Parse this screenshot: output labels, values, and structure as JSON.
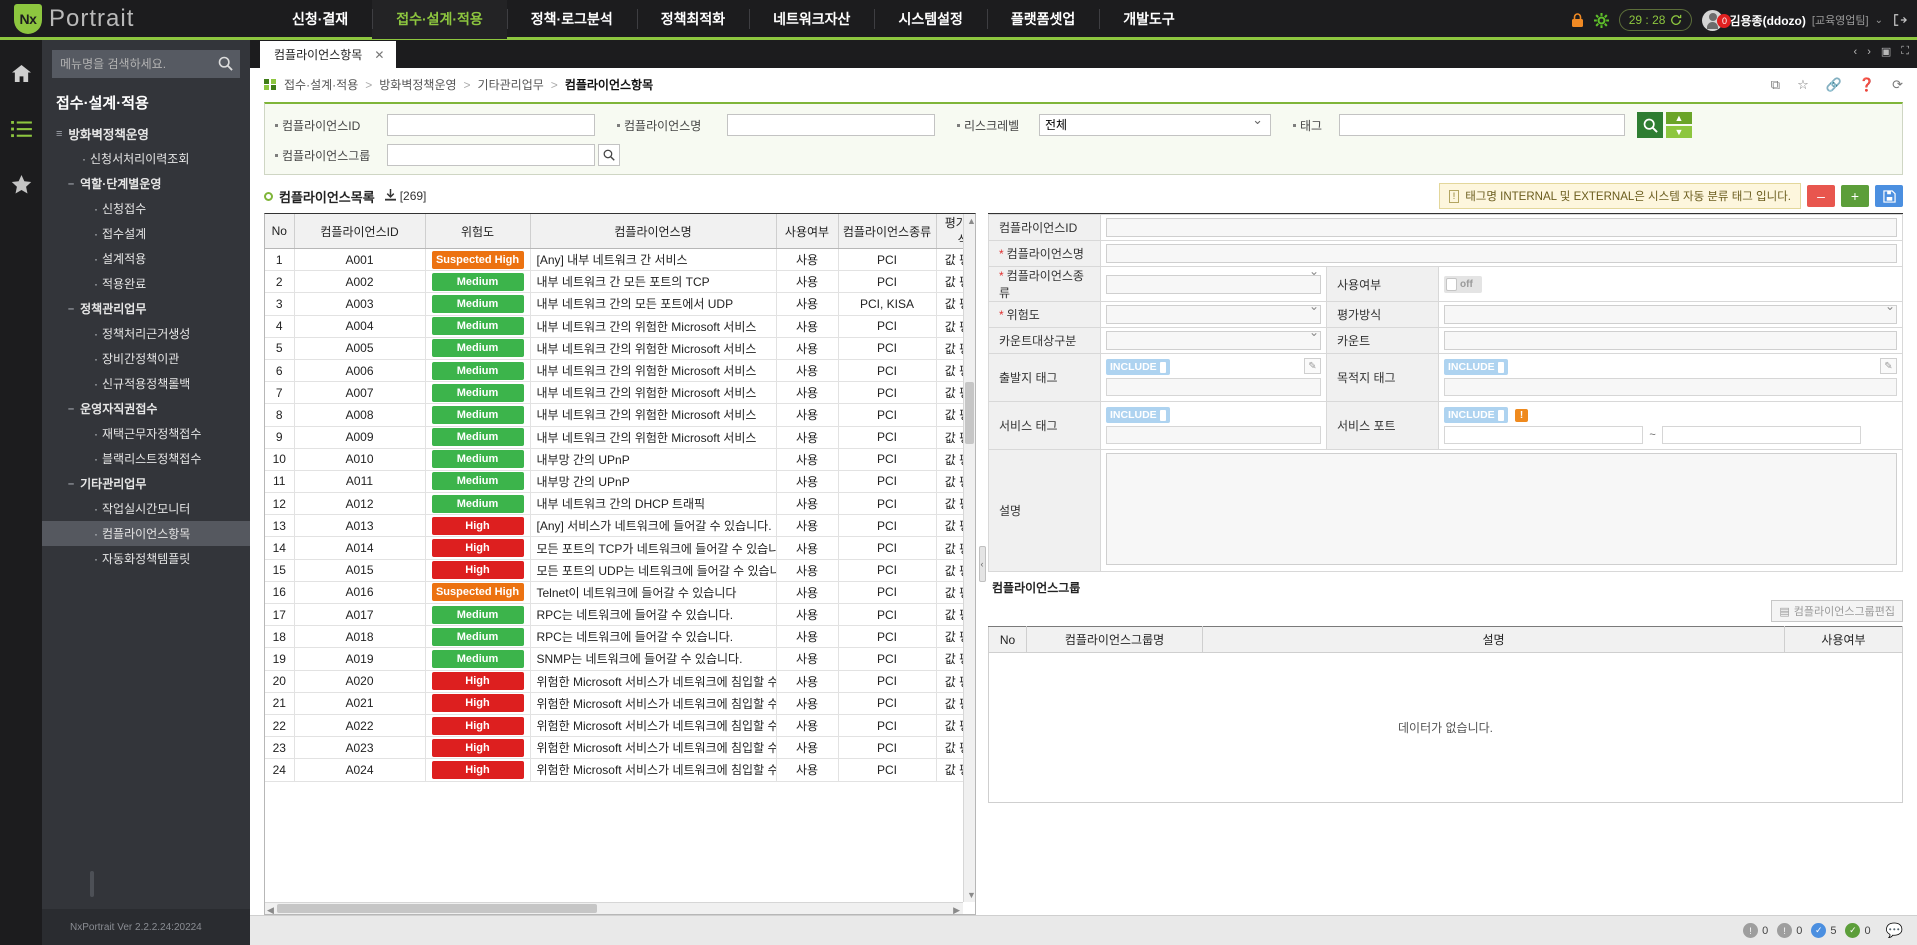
{
  "app": {
    "logo_mark": "Nx",
    "logo_text": "Portrait",
    "version": "NxPortrait  Ver 2.2.2.24:20224"
  },
  "header": {
    "nav": [
      {
        "label": "신청·결재",
        "active": false
      },
      {
        "label": "접수·설계·적용",
        "active": true
      },
      {
        "label": "정책·로그분석",
        "active": false
      },
      {
        "label": "정책최적화",
        "active": false
      },
      {
        "label": "네트워크자산",
        "active": false
      },
      {
        "label": "시스템설정",
        "active": false
      },
      {
        "label": "플랫폼셋업",
        "active": false
      },
      {
        "label": "개발도구",
        "active": false
      }
    ],
    "lock_icon": "lock-icon",
    "gear_icon": "gear-icon",
    "session_timer": "29 : 28",
    "refresh_icon": "session-refresh-icon",
    "notification_count": "0",
    "user_name": "김용종(ddozo)",
    "user_team": "[교육영업팀]",
    "logout_icon": "logout-icon"
  },
  "rail": {
    "home_icon": "home-icon",
    "menu_icon": "menu-list-icon",
    "favorite_icon": "star-icon"
  },
  "sidebar": {
    "search_placeholder": "메뉴명을 검색하세요.",
    "search_icon": "search-icon",
    "title": "접수·설계·적용",
    "tree": [
      {
        "label": "방화벽정책운영",
        "level": 1,
        "marker": "≡",
        "selected": false
      },
      {
        "label": "신청서처리이력조회",
        "level": 3,
        "marker": "·",
        "selected": false
      },
      {
        "label": "역할·단계별운영",
        "level": 2,
        "marker": "–",
        "selected": false
      },
      {
        "label": "신청접수",
        "level": 4,
        "marker": "·",
        "selected": false
      },
      {
        "label": "접수설계",
        "level": 4,
        "marker": "·",
        "selected": false
      },
      {
        "label": "설계적용",
        "level": 4,
        "marker": "·",
        "selected": false
      },
      {
        "label": "적용완료",
        "level": 4,
        "marker": "·",
        "selected": false
      },
      {
        "label": "정책관리업무",
        "level": 2,
        "marker": "–",
        "selected": false
      },
      {
        "label": "정책처리근거생성",
        "level": 4,
        "marker": "·",
        "selected": false
      },
      {
        "label": "장비간정책이관",
        "level": 4,
        "marker": "·",
        "selected": false
      },
      {
        "label": "신규적용정책롤백",
        "level": 4,
        "marker": "·",
        "selected": false
      },
      {
        "label": "운영자직권접수",
        "level": 2,
        "marker": "–",
        "selected": false
      },
      {
        "label": "재택근무자정책접수",
        "level": 4,
        "marker": "·",
        "selected": false
      },
      {
        "label": "블랙리스트정책접수",
        "level": 4,
        "marker": "·",
        "selected": false
      },
      {
        "label": "기타관리업무",
        "level": 2,
        "marker": "–",
        "selected": false
      },
      {
        "label": "작업실시간모니터",
        "level": 4,
        "marker": "·",
        "selected": false
      },
      {
        "label": "컴플라이언스항목",
        "level": 4,
        "marker": "·",
        "selected": true
      },
      {
        "label": "자동화정책템플릿",
        "level": 4,
        "marker": "·",
        "selected": false
      }
    ]
  },
  "tabs": {
    "items": [
      {
        "label": "컴플라이언스항목",
        "close_icon": "close-icon"
      }
    ],
    "prev_icon": "chevron-left-icon",
    "next_icon": "chevron-right-icon",
    "window_icon": "window-icon",
    "expand_icon": "expand-icon"
  },
  "breadcrumb": {
    "grid_icon": "grid-icon",
    "items": [
      "접수·설계·적용",
      "방화벽정책운영",
      "기타관리업무"
    ],
    "current": "컴플라이언스항목",
    "actions": [
      "screen-capture-icon",
      "favorite-star-icon",
      "link-icon",
      "help-icon",
      "refresh-icon"
    ]
  },
  "search_form": {
    "fields": [
      {
        "label": "컴플라이언스ID",
        "value": "",
        "type": "text"
      },
      {
        "label": "컴플라이언스명",
        "value": "",
        "type": "text"
      },
      {
        "label": "리스크레벨",
        "value": "전체",
        "type": "select"
      },
      {
        "label": "태그",
        "value": "",
        "type": "text"
      },
      {
        "label": "컴플라이언스그룹",
        "value": "",
        "type": "text-with-search"
      }
    ],
    "search_icon": "search-icon",
    "popup_icon": "popup-search-icon",
    "collapse_icon": "collapse-icon"
  },
  "list_header": {
    "title": "컴플라이언스목록",
    "download_icon": "download-icon",
    "count": "[269]",
    "notice_icon": "exclamation-icon",
    "notice_text": "태그명 INTERNAL 및 EXTERNAL은 시스템 자동 분류 태그 입니다.",
    "buttons": [
      {
        "name": "delete-button",
        "glyph": "–",
        "color": "#e8564e"
      },
      {
        "name": "add-button",
        "glyph": "+",
        "color": "#5c9e3a"
      },
      {
        "name": "save-button",
        "glyph": "save-icon",
        "color": "#4b8fe0"
      }
    ]
  },
  "grid": {
    "columns": [
      "No",
      "컴플라이언스ID",
      "위험도",
      "컴플라이언스명",
      "사용여부",
      "컴플라이언스종류",
      "평가 방식"
    ],
    "rows": [
      {
        "no": "1",
        "id": "A001",
        "risk": "Suspected High",
        "risk_class": "p-sus",
        "name": "[Any] 내부 네트워크 간 서비스",
        "use": "사용",
        "kind": "PCI",
        "eval": "값 평가"
      },
      {
        "no": "2",
        "id": "A002",
        "risk": "Medium",
        "risk_class": "p-med",
        "name": "내부 네트워크 간 모든 포트의 TCP",
        "use": "사용",
        "kind": "PCI",
        "eval": "값 평가"
      },
      {
        "no": "3",
        "id": "A003",
        "risk": "Medium",
        "risk_class": "p-med",
        "name": "내부 네트워크 간의 모든 포트에서 UDP",
        "use": "사용",
        "kind": "PCI, KISA",
        "eval": "값 평가"
      },
      {
        "no": "4",
        "id": "A004",
        "risk": "Medium",
        "risk_class": "p-med",
        "name": "내부 네트워크 간의 위험한 Microsoft 서비스",
        "use": "사용",
        "kind": "PCI",
        "eval": "값 평가"
      },
      {
        "no": "5",
        "id": "A005",
        "risk": "Medium",
        "risk_class": "p-med",
        "name": "내부 네트워크 간의 위험한 Microsoft 서비스",
        "use": "사용",
        "kind": "PCI",
        "eval": "값 평가"
      },
      {
        "no": "6",
        "id": "A006",
        "risk": "Medium",
        "risk_class": "p-med",
        "name": "내부 네트워크 간의 위험한 Microsoft 서비스",
        "use": "사용",
        "kind": "PCI",
        "eval": "값 평가"
      },
      {
        "no": "7",
        "id": "A007",
        "risk": "Medium",
        "risk_class": "p-med",
        "name": "내부 네트워크 간의 위험한 Microsoft 서비스",
        "use": "사용",
        "kind": "PCI",
        "eval": "값 평가"
      },
      {
        "no": "8",
        "id": "A008",
        "risk": "Medium",
        "risk_class": "p-med",
        "name": "내부 네트워크 간의 위험한 Microsoft 서비스",
        "use": "사용",
        "kind": "PCI",
        "eval": "값 평가"
      },
      {
        "no": "9",
        "id": "A009",
        "risk": "Medium",
        "risk_class": "p-med",
        "name": "내부 네트워크 간의 위험한 Microsoft 서비스",
        "use": "사용",
        "kind": "PCI",
        "eval": "값 평가"
      },
      {
        "no": "10",
        "id": "A010",
        "risk": "Medium",
        "risk_class": "p-med",
        "name": "내부망 간의 UPnP",
        "use": "사용",
        "kind": "PCI",
        "eval": "값 평가"
      },
      {
        "no": "11",
        "id": "A011",
        "risk": "Medium",
        "risk_class": "p-med",
        "name": "내부망 간의 UPnP",
        "use": "사용",
        "kind": "PCI",
        "eval": "값 평가"
      },
      {
        "no": "12",
        "id": "A012",
        "risk": "Medium",
        "risk_class": "p-med",
        "name": "내부 네트워크 간의 DHCP 트래픽",
        "use": "사용",
        "kind": "PCI",
        "eval": "값 평가"
      },
      {
        "no": "13",
        "id": "A013",
        "risk": "High",
        "risk_class": "p-high",
        "name": "[Any] 서비스가 네트워크에 들어갈 수 있습니다.",
        "use": "사용",
        "kind": "PCI",
        "eval": "값 평가"
      },
      {
        "no": "14",
        "id": "A014",
        "risk": "High",
        "risk_class": "p-high",
        "name": "모든 포트의 TCP가 네트워크에 들어갈 수 있습니다.",
        "use": "사용",
        "kind": "PCI",
        "eval": "값 평가"
      },
      {
        "no": "15",
        "id": "A015",
        "risk": "High",
        "risk_class": "p-high",
        "name": "모든 포트의 UDP는 네트워크에 들어갈 수 있습니다.",
        "use": "사용",
        "kind": "PCI",
        "eval": "값 평가"
      },
      {
        "no": "16",
        "id": "A016",
        "risk": "Suspected High",
        "risk_class": "p-sus",
        "name": "Telnet이 네트워크에 들어갈 수 있습니다",
        "use": "사용",
        "kind": "PCI",
        "eval": "값 평가"
      },
      {
        "no": "17",
        "id": "A017",
        "risk": "Medium",
        "risk_class": "p-med",
        "name": "RPC는 네트워크에 들어갈 수 있습니다.",
        "use": "사용",
        "kind": "PCI",
        "eval": "값 평가"
      },
      {
        "no": "18",
        "id": "A018",
        "risk": "Medium",
        "risk_class": "p-med",
        "name": "RPC는 네트워크에 들어갈 수 있습니다.",
        "use": "사용",
        "kind": "PCI",
        "eval": "값 평가"
      },
      {
        "no": "19",
        "id": "A019",
        "risk": "Medium",
        "risk_class": "p-med",
        "name": "SNMP는 네트워크에 들어갈 수 있습니다.",
        "use": "사용",
        "kind": "PCI",
        "eval": "값 평가"
      },
      {
        "no": "20",
        "id": "A020",
        "risk": "High",
        "risk_class": "p-high",
        "name": "위험한 Microsoft 서비스가 네트워크에 침입할 수 있슽",
        "use": "사용",
        "kind": "PCI",
        "eval": "값 평가"
      },
      {
        "no": "21",
        "id": "A021",
        "risk": "High",
        "risk_class": "p-high",
        "name": "위험한 Microsoft 서비스가 네트워크에 침입할 수 있슽",
        "use": "사용",
        "kind": "PCI",
        "eval": "값 평가"
      },
      {
        "no": "22",
        "id": "A022",
        "risk": "High",
        "risk_class": "p-high",
        "name": "위험한 Microsoft 서비스가 네트워크에 침입할 수 있슽",
        "use": "사용",
        "kind": "PCI",
        "eval": "값 평가"
      },
      {
        "no": "23",
        "id": "A023",
        "risk": "High",
        "risk_class": "p-high",
        "name": "위험한 Microsoft 서비스가 네트워크에 침입할 수 있슽",
        "use": "사용",
        "kind": "PCI",
        "eval": "값 평가"
      },
      {
        "no": "24",
        "id": "A024",
        "risk": "High",
        "risk_class": "p-high",
        "name": "위험한 Microsoft 서비스가 네트워크에 침입할 수 있슽",
        "use": "사용",
        "kind": "PCI",
        "eval": "값 평가"
      }
    ]
  },
  "detail": {
    "labels": {
      "id": "컴플라이언스ID",
      "name": "컴플라이언스명",
      "kind": "컴플라이언스종류",
      "use": "사용여부",
      "risk": "위험도",
      "eval_method": "평가방식",
      "count_target": "카운트대상구분",
      "count": "카운트",
      "src_tag": "출발지 태그",
      "dst_tag": "목적지 태그",
      "svc_tag": "서비스 태그",
      "svc_port": "서비스 포트",
      "desc": "설명"
    },
    "values": {
      "id": "",
      "name": "",
      "kind": "",
      "risk": "",
      "eval_method": "",
      "count_target": "",
      "count": "",
      "desc": "",
      "port_from": "",
      "port_to": "",
      "port_sep": "~"
    },
    "toggle_off_label": "off",
    "tag_chip_label": "INCLUDE",
    "edit_icon": "pencil-icon",
    "warn_icon": "warning-icon",
    "group": {
      "title": "컴플라이언스그룹",
      "edit_button": "컴플라이언스그룹편집",
      "edit_button_icon": "edit-icon",
      "columns": [
        "No",
        "컴플라이언스그룹명",
        "설명",
        "사용여부"
      ],
      "empty_text": "데이터가 없습니다."
    }
  },
  "statusbar": {
    "items": [
      {
        "icon": "gray-circle-icon",
        "color_class": "sc-g",
        "glyph": "!",
        "count": "0"
      },
      {
        "icon": "gray-circle-icon",
        "color_class": "sc-g",
        "glyph": "!",
        "count": "0"
      },
      {
        "icon": "blue-check-icon",
        "color_class": "sc-b",
        "glyph": "✓",
        "count": "5"
      },
      {
        "icon": "green-check-icon",
        "color_class": "sc-gr",
        "glyph": "✓",
        "count": "0"
      }
    ],
    "chat_icon": "chat-icon"
  }
}
